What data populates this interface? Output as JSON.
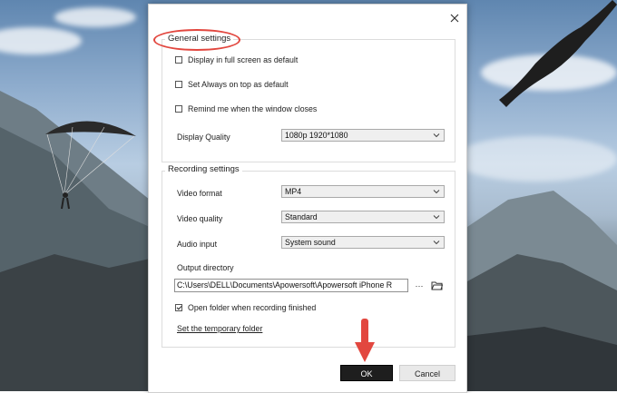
{
  "dialog": {
    "general": {
      "title": "General settings",
      "full_screen": {
        "label": "Display in full screen as default",
        "checked": false
      },
      "always_on_top": {
        "label": "Set Always on top as default",
        "checked": false
      },
      "remind_close": {
        "label": "Remind me when the window closes",
        "checked": false
      },
      "quality_label": "Display Quality",
      "quality_value": "1080p 1920*1080"
    },
    "recording": {
      "title": "Recording settings",
      "video_format_label": "Video format",
      "video_format_value": "MP4",
      "video_quality_label": "Video quality",
      "video_quality_value": "Standard",
      "audio_input_label": "Audio input",
      "audio_input_value": "System sound",
      "output_dir_label": "Output directory",
      "output_dir_value": "C:\\Users\\DELL\\Documents\\Apowersoft\\Apowersoft iPhone R",
      "more_label": "···",
      "open_folder": {
        "label": "Open folder when recording finished",
        "checked": true
      },
      "temp_folder_link": "Set the temporary folder"
    },
    "buttons": {
      "ok": "OK",
      "cancel": "Cancel"
    }
  },
  "colors": {
    "annotation": "#e2473f",
    "ok_bg": "#1e1e1e"
  },
  "icons": [
    "close-icon",
    "chevron-down-icon",
    "folder-icon",
    "arrow-down-annotation"
  ]
}
